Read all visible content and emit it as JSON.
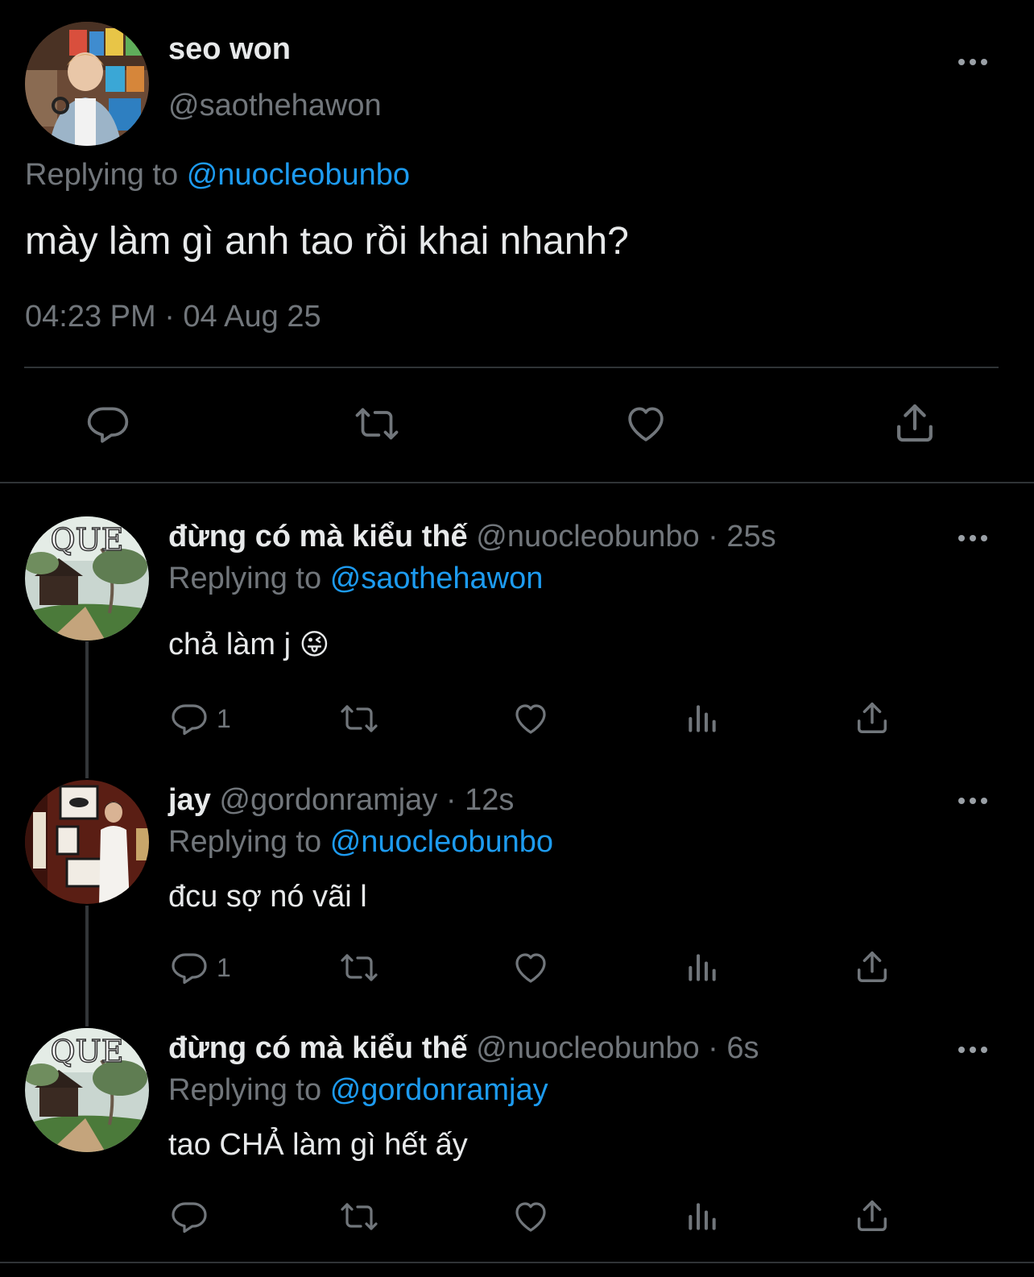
{
  "main_tweet": {
    "display_name": "seo won",
    "handle": "@saothehawon",
    "replying_prefix": "Replying to",
    "replying_handle": "@nuocleobunbo",
    "text": "mày làm gì anh tao rồi khai nhanh?",
    "timestamp": "04:23 PM · 04 Aug 25"
  },
  "replies": [
    {
      "display_name": "đừng có mà kiểu thế",
      "meta": "@nuocleobunbo · 25s",
      "replying_prefix": "Replying to",
      "replying_handle": "@saothehawon",
      "text": "chả làm j",
      "emoji": "😜",
      "reply_count": "1",
      "avatar_text": "QUE"
    },
    {
      "display_name": "jay",
      "meta": "@gordonramjay · 12s",
      "replying_prefix": "Replying to",
      "replying_handle": "@nuocleobunbo",
      "text": "đcu sợ nó vãi l",
      "reply_count": "1"
    },
    {
      "display_name": "đừng có mà kiểu thế",
      "meta": "@nuocleobunbo · 6s",
      "replying_prefix": "Replying to",
      "replying_handle": "@gordonramjay",
      "text": "tao CHẢ làm gì hết ấy",
      "reply_count": "",
      "avatar_text": "QUE"
    }
  ],
  "icons": {
    "reply": "reply-icon",
    "retweet": "retweet-icon",
    "like": "heart-icon",
    "views": "views-icon",
    "share": "share-icon",
    "more": "more-icon"
  },
  "colors": {
    "background": "#000000",
    "text": "#e7e9ea",
    "secondary": "#71767b",
    "link": "#1d9bf0",
    "divider": "#2f3336"
  }
}
